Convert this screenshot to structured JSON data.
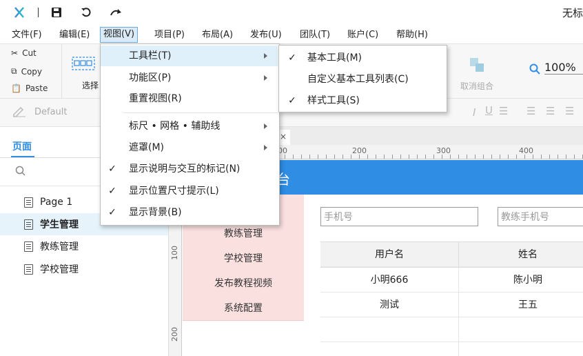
{
  "window": {
    "title": "无标"
  },
  "menubar": [
    {
      "label": "文件(F)"
    },
    {
      "label": "编辑(E)"
    },
    {
      "label": "视图(V)"
    },
    {
      "label": "项目(P)"
    },
    {
      "label": "布局(A)"
    },
    {
      "label": "发布(U)"
    },
    {
      "label": "团队(T)"
    },
    {
      "label": "账户(C)"
    },
    {
      "label": "帮助(H)"
    }
  ],
  "clipboard": {
    "cut": "Cut",
    "copy": "Copy",
    "paste": "Paste"
  },
  "toolbar": {
    "select_label": "选择",
    "ungroup_label": "取消组合",
    "zoom": "100%"
  },
  "stylebar": {
    "style_name": "Default"
  },
  "left_panel": {
    "tab_pages": "页面",
    "pages": [
      {
        "label": "Page 1"
      },
      {
        "label": "学生管理"
      },
      {
        "label": "教练管理"
      },
      {
        "label": "学校管理"
      }
    ]
  },
  "canvas": {
    "tab_close": "×",
    "ruler_h": [
      "00",
      "200",
      "300",
      "400"
    ],
    "ruler_v": [
      "100",
      "200"
    ],
    "header_text": "台",
    "nav": [
      "教练管理",
      "学校管理",
      "发布教程视频",
      "系统配置"
    ],
    "inputs": {
      "phone_placeholder": "手机号",
      "coach_phone_placeholder": "教练手机号"
    },
    "table": {
      "headers": [
        "用户名",
        "姓名"
      ],
      "rows": [
        [
          "小明666",
          "陈小明"
        ],
        [
          "测试",
          "王五"
        ]
      ]
    }
  },
  "view_menu": {
    "items": [
      {
        "label": "工具栏(T)"
      },
      {
        "label": "功能区(P)"
      },
      {
        "label": "重置视图(R)"
      },
      {
        "label": "标尺 • 网格 • 辅助线"
      },
      {
        "label": "遮罩(M)"
      },
      {
        "label": "显示说明与交互的标记(N)"
      },
      {
        "label": "显示位置尺寸提示(L)"
      },
      {
        "label": "显示背景(B)"
      }
    ]
  },
  "toolbar_submenu": {
    "items": [
      {
        "label": "基本工具(M)"
      },
      {
        "label": "自定义基本工具列表(C)"
      },
      {
        "label": "样式工具(S)"
      }
    ]
  },
  "icons": {
    "check": "✓"
  },
  "colors": {
    "accent": "#2f8de4",
    "nav_bg": "#fbe0e0",
    "highlight": "#dff0fa",
    "logo": "#3a8fd6"
  }
}
